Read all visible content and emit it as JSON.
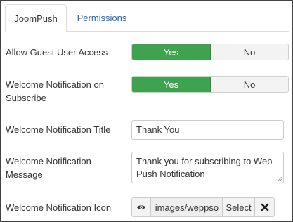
{
  "tabs": [
    {
      "label": "JoomPush",
      "active": true
    },
    {
      "label": "Permissions",
      "active": false
    }
  ],
  "fields": {
    "guest_access": {
      "label": "Allow Guest User Access",
      "yes_label": "Yes",
      "no_label": "No",
      "selected": "Yes"
    },
    "welcome_on_subscribe": {
      "label": "Welcome Notification on Subscribe",
      "yes_label": "Yes",
      "no_label": "No",
      "selected": "Yes"
    },
    "welcome_title": {
      "label": "Welcome Notification Title",
      "value": "Thank You"
    },
    "welcome_message": {
      "label": "Welcome Notification Message",
      "value": "Thank you for subscribing to Web Push Notification"
    },
    "welcome_icon": {
      "label": "Welcome Notification Icon",
      "value": "images/weppso",
      "select_label": "Select",
      "icons": {
        "preview": "eye-icon",
        "clear": "close-icon"
      }
    }
  },
  "colors": {
    "yes_active": "#3fa24e",
    "link_tab": "#2a69b8",
    "no_background": "#f3f3f3"
  }
}
